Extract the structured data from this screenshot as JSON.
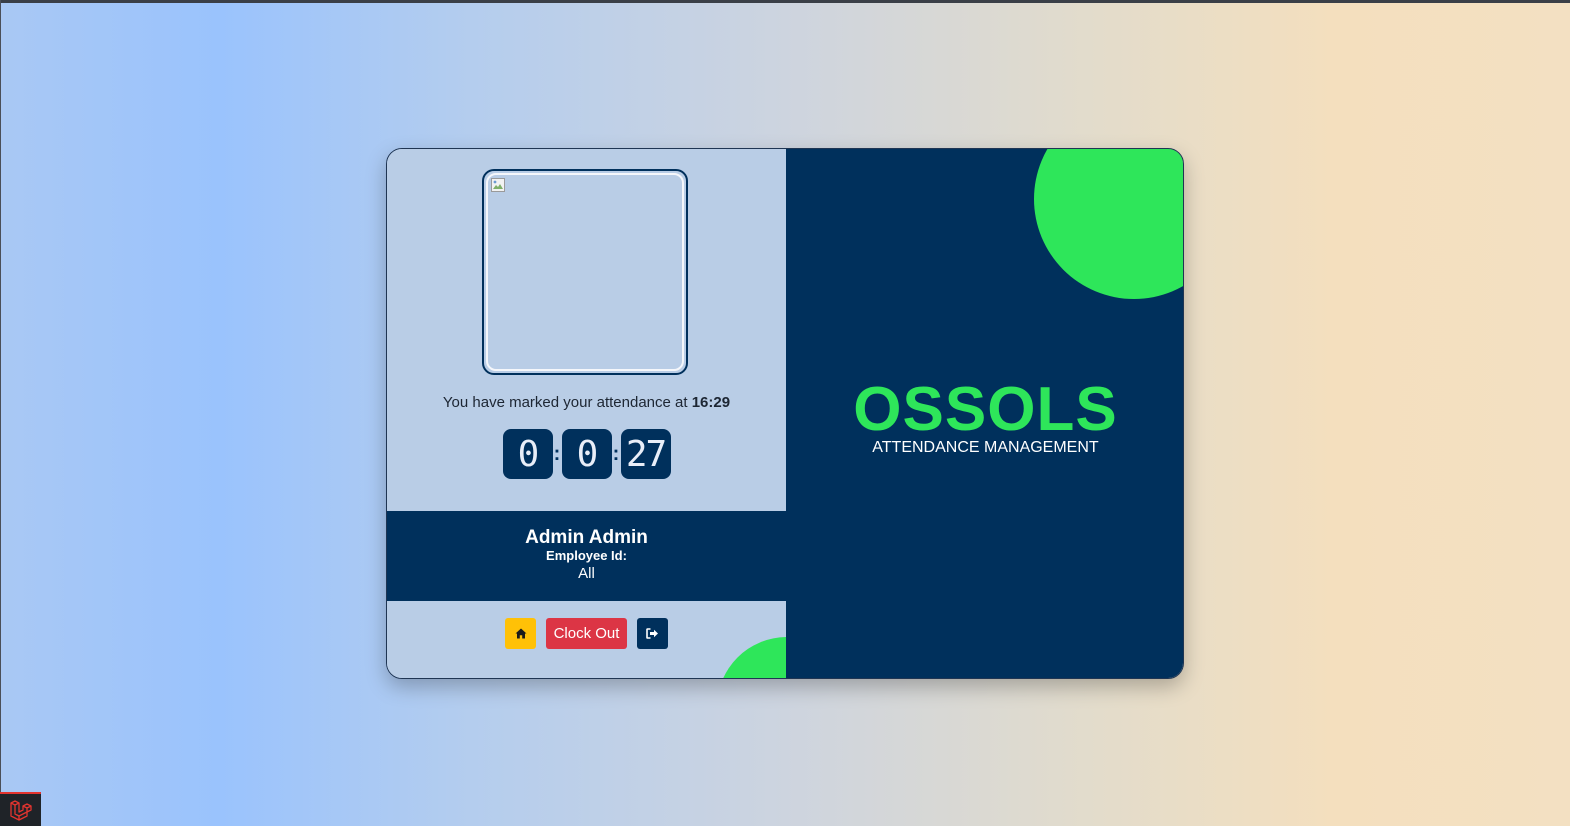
{
  "attendance": {
    "message_prefix": "You have marked your attendance at",
    "time": "16:29"
  },
  "timer": {
    "hours": "0",
    "minutes": "0",
    "seconds": "27",
    "separator": ":"
  },
  "user": {
    "name": "Admin Admin",
    "employee_id_label": "Employee Id:",
    "employee_id_value": "All"
  },
  "actions": {
    "home_icon": "home-icon",
    "clock_out_label": "Clock Out",
    "logout_icon": "sign-out-icon"
  },
  "brand": {
    "name": "OSSOLS",
    "tagline": "ATTENDANCE MANAGEMENT"
  },
  "colors": {
    "navy": "#00305c",
    "green": "#2ee65a",
    "panel": "#b9cde6",
    "home_button": "#ffc107",
    "clock_out_button": "#dc3545"
  },
  "badge": {
    "icon": "laravel-icon"
  }
}
